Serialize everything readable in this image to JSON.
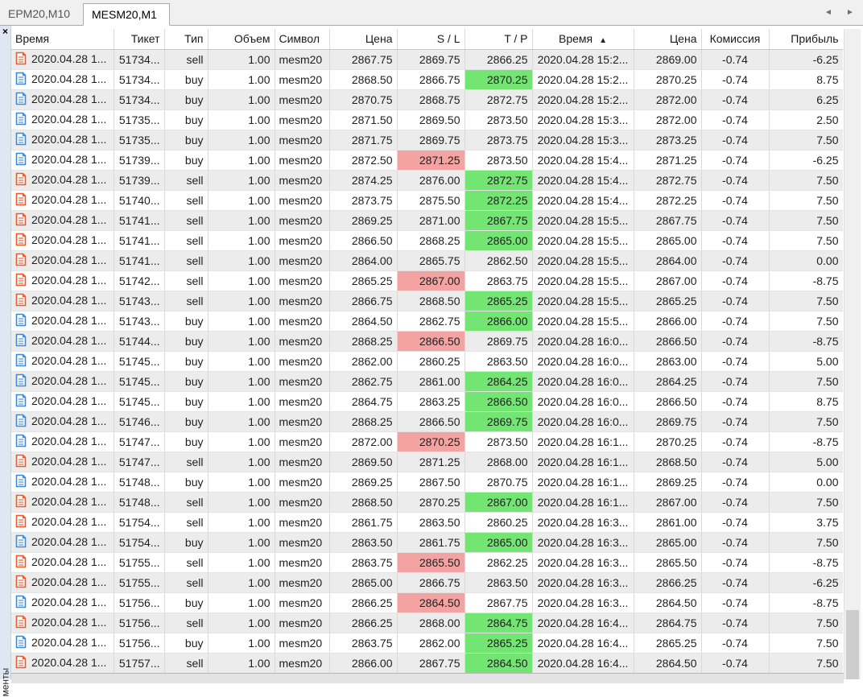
{
  "tabs": [
    {
      "label": "EPM20,M10",
      "active": false
    },
    {
      "label": "MESM20,M1",
      "active": true
    }
  ],
  "scroll": {
    "left_arrow": "◄",
    "right_arrow": "►"
  },
  "sidebar": {
    "close": "×",
    "label": "менты"
  },
  "colors": {
    "row_odd": "#ececec",
    "row_even": "#ffffff",
    "tp_hit": "#73e573",
    "sl_hit": "#f4a3a3",
    "sell_icon": "#e8592c",
    "buy_icon": "#3b8ad9"
  },
  "columns": [
    {
      "label": "Время",
      "align": "l"
    },
    {
      "label": "Тикет",
      "align": "r"
    },
    {
      "label": "Тип",
      "align": "r"
    },
    {
      "label": "Объем",
      "align": "r"
    },
    {
      "label": "Символ",
      "align": "l"
    },
    {
      "label": "Цена",
      "align": "r"
    },
    {
      "label": "S / L",
      "align": "r"
    },
    {
      "label": "T / P",
      "align": "r"
    },
    {
      "label": "Время",
      "align": "c",
      "sorted": "asc"
    },
    {
      "label": "Цена",
      "align": "r"
    },
    {
      "label": "Комиссия",
      "align": "c"
    },
    {
      "label": "Прибыль",
      "align": "r"
    }
  ],
  "sort_indicator": "▲",
  "rows": [
    {
      "time": "2020.04.28 1...",
      "ticket": "51734...",
      "type": "sell",
      "volume": "1.00",
      "symbol": "mesm20",
      "price": "2867.75",
      "sl": "2869.75",
      "tp": "2866.25",
      "close_time": "2020.04.28 15:2...",
      "close_price": "2869.00",
      "commission": "-0.74",
      "profit": "-6.25",
      "hl": ""
    },
    {
      "time": "2020.04.28 1...",
      "ticket": "51734...",
      "type": "buy",
      "volume": "1.00",
      "symbol": "mesm20",
      "price": "2868.50",
      "sl": "2866.75",
      "tp": "2870.25",
      "close_time": "2020.04.28 15:2...",
      "close_price": "2870.25",
      "commission": "-0.74",
      "profit": "8.75",
      "hl": "tp"
    },
    {
      "time": "2020.04.28 1...",
      "ticket": "51734...",
      "type": "buy",
      "volume": "1.00",
      "symbol": "mesm20",
      "price": "2870.75",
      "sl": "2868.75",
      "tp": "2872.75",
      "close_time": "2020.04.28 15:2...",
      "close_price": "2872.00",
      "commission": "-0.74",
      "profit": "6.25",
      "hl": ""
    },
    {
      "time": "2020.04.28 1...",
      "ticket": "51735...",
      "type": "buy",
      "volume": "1.00",
      "symbol": "mesm20",
      "price": "2871.50",
      "sl": "2869.50",
      "tp": "2873.50",
      "close_time": "2020.04.28 15:3...",
      "close_price": "2872.00",
      "commission": "-0.74",
      "profit": "2.50",
      "hl": ""
    },
    {
      "time": "2020.04.28 1...",
      "ticket": "51735...",
      "type": "buy",
      "volume": "1.00",
      "symbol": "mesm20",
      "price": "2871.75",
      "sl": "2869.75",
      "tp": "2873.75",
      "close_time": "2020.04.28 15:3...",
      "close_price": "2873.25",
      "commission": "-0.74",
      "profit": "7.50",
      "hl": ""
    },
    {
      "time": "2020.04.28 1...",
      "ticket": "51739...",
      "type": "buy",
      "volume": "1.00",
      "symbol": "mesm20",
      "price": "2872.50",
      "sl": "2871.25",
      "tp": "2873.50",
      "close_time": "2020.04.28 15:4...",
      "close_price": "2871.25",
      "commission": "-0.74",
      "profit": "-6.25",
      "hl": "sl"
    },
    {
      "time": "2020.04.28 1...",
      "ticket": "51739...",
      "type": "sell",
      "volume": "1.00",
      "symbol": "mesm20",
      "price": "2874.25",
      "sl": "2876.00",
      "tp": "2872.75",
      "close_time": "2020.04.28 15:4...",
      "close_price": "2872.75",
      "commission": "-0.74",
      "profit": "7.50",
      "hl": "tp"
    },
    {
      "time": "2020.04.28 1...",
      "ticket": "51740...",
      "type": "sell",
      "volume": "1.00",
      "symbol": "mesm20",
      "price": "2873.75",
      "sl": "2875.50",
      "tp": "2872.25",
      "close_time": "2020.04.28 15:4...",
      "close_price": "2872.25",
      "commission": "-0.74",
      "profit": "7.50",
      "hl": "tp"
    },
    {
      "time": "2020.04.28 1...",
      "ticket": "51741...",
      "type": "sell",
      "volume": "1.00",
      "symbol": "mesm20",
      "price": "2869.25",
      "sl": "2871.00",
      "tp": "2867.75",
      "close_time": "2020.04.28 15:5...",
      "close_price": "2867.75",
      "commission": "-0.74",
      "profit": "7.50",
      "hl": "tp"
    },
    {
      "time": "2020.04.28 1...",
      "ticket": "51741...",
      "type": "sell",
      "volume": "1.00",
      "symbol": "mesm20",
      "price": "2866.50",
      "sl": "2868.25",
      "tp": "2865.00",
      "close_time": "2020.04.28 15:5...",
      "close_price": "2865.00",
      "commission": "-0.74",
      "profit": "7.50",
      "hl": "tp"
    },
    {
      "time": "2020.04.28 1...",
      "ticket": "51741...",
      "type": "sell",
      "volume": "1.00",
      "symbol": "mesm20",
      "price": "2864.00",
      "sl": "2865.75",
      "tp": "2862.50",
      "close_time": "2020.04.28 15:5...",
      "close_price": "2864.00",
      "commission": "-0.74",
      "profit": "0.00",
      "hl": ""
    },
    {
      "time": "2020.04.28 1...",
      "ticket": "51742...",
      "type": "sell",
      "volume": "1.00",
      "symbol": "mesm20",
      "price": "2865.25",
      "sl": "2867.00",
      "tp": "2863.75",
      "close_time": "2020.04.28 15:5...",
      "close_price": "2867.00",
      "commission": "-0.74",
      "profit": "-8.75",
      "hl": "sl"
    },
    {
      "time": "2020.04.28 1...",
      "ticket": "51743...",
      "type": "sell",
      "volume": "1.00",
      "symbol": "mesm20",
      "price": "2866.75",
      "sl": "2868.50",
      "tp": "2865.25",
      "close_time": "2020.04.28 15:5...",
      "close_price": "2865.25",
      "commission": "-0.74",
      "profit": "7.50",
      "hl": "tp"
    },
    {
      "time": "2020.04.28 1...",
      "ticket": "51743...",
      "type": "buy",
      "volume": "1.00",
      "symbol": "mesm20",
      "price": "2864.50",
      "sl": "2862.75",
      "tp": "2866.00",
      "close_time": "2020.04.28 15:5...",
      "close_price": "2866.00",
      "commission": "-0.74",
      "profit": "7.50",
      "hl": "tp"
    },
    {
      "time": "2020.04.28 1...",
      "ticket": "51744...",
      "type": "buy",
      "volume": "1.00",
      "symbol": "mesm20",
      "price": "2868.25",
      "sl": "2866.50",
      "tp": "2869.75",
      "close_time": "2020.04.28 16:0...",
      "close_price": "2866.50",
      "commission": "-0.74",
      "profit": "-8.75",
      "hl": "sl"
    },
    {
      "time": "2020.04.28 1...",
      "ticket": "51745...",
      "type": "buy",
      "volume": "1.00",
      "symbol": "mesm20",
      "price": "2862.00",
      "sl": "2860.25",
      "tp": "2863.50",
      "close_time": "2020.04.28 16:0...",
      "close_price": "2863.00",
      "commission": "-0.74",
      "profit": "5.00",
      "hl": ""
    },
    {
      "time": "2020.04.28 1...",
      "ticket": "51745...",
      "type": "buy",
      "volume": "1.00",
      "symbol": "mesm20",
      "price": "2862.75",
      "sl": "2861.00",
      "tp": "2864.25",
      "close_time": "2020.04.28 16:0...",
      "close_price": "2864.25",
      "commission": "-0.74",
      "profit": "7.50",
      "hl": "tp"
    },
    {
      "time": "2020.04.28 1...",
      "ticket": "51745...",
      "type": "buy",
      "volume": "1.00",
      "symbol": "mesm20",
      "price": "2864.75",
      "sl": "2863.25",
      "tp": "2866.50",
      "close_time": "2020.04.28 16:0...",
      "close_price": "2866.50",
      "commission": "-0.74",
      "profit": "8.75",
      "hl": "tp"
    },
    {
      "time": "2020.04.28 1...",
      "ticket": "51746...",
      "type": "buy",
      "volume": "1.00",
      "symbol": "mesm20",
      "price": "2868.25",
      "sl": "2866.50",
      "tp": "2869.75",
      "close_time": "2020.04.28 16:0...",
      "close_price": "2869.75",
      "commission": "-0.74",
      "profit": "7.50",
      "hl": "tp"
    },
    {
      "time": "2020.04.28 1...",
      "ticket": "51747...",
      "type": "buy",
      "volume": "1.00",
      "symbol": "mesm20",
      "price": "2872.00",
      "sl": "2870.25",
      "tp": "2873.50",
      "close_time": "2020.04.28 16:1...",
      "close_price": "2870.25",
      "commission": "-0.74",
      "profit": "-8.75",
      "hl": "sl"
    },
    {
      "time": "2020.04.28 1...",
      "ticket": "51747...",
      "type": "sell",
      "volume": "1.00",
      "symbol": "mesm20",
      "price": "2869.50",
      "sl": "2871.25",
      "tp": "2868.00",
      "close_time": "2020.04.28 16:1...",
      "close_price": "2868.50",
      "commission": "-0.74",
      "profit": "5.00",
      "hl": ""
    },
    {
      "time": "2020.04.28 1...",
      "ticket": "51748...",
      "type": "buy",
      "volume": "1.00",
      "symbol": "mesm20",
      "price": "2869.25",
      "sl": "2867.50",
      "tp": "2870.75",
      "close_time": "2020.04.28 16:1...",
      "close_price": "2869.25",
      "commission": "-0.74",
      "profit": "0.00",
      "hl": ""
    },
    {
      "time": "2020.04.28 1...",
      "ticket": "51748...",
      "type": "sell",
      "volume": "1.00",
      "symbol": "mesm20",
      "price": "2868.50",
      "sl": "2870.25",
      "tp": "2867.00",
      "close_time": "2020.04.28 16:1...",
      "close_price": "2867.00",
      "commission": "-0.74",
      "profit": "7.50",
      "hl": "tp"
    },
    {
      "time": "2020.04.28 1...",
      "ticket": "51754...",
      "type": "sell",
      "volume": "1.00",
      "symbol": "mesm20",
      "price": "2861.75",
      "sl": "2863.50",
      "tp": "2860.25",
      "close_time": "2020.04.28 16:3...",
      "close_price": "2861.00",
      "commission": "-0.74",
      "profit": "3.75",
      "hl": ""
    },
    {
      "time": "2020.04.28 1...",
      "ticket": "51754...",
      "type": "buy",
      "volume": "1.00",
      "symbol": "mesm20",
      "price": "2863.50",
      "sl": "2861.75",
      "tp": "2865.00",
      "close_time": "2020.04.28 16:3...",
      "close_price": "2865.00",
      "commission": "-0.74",
      "profit": "7.50",
      "hl": "tp"
    },
    {
      "time": "2020.04.28 1...",
      "ticket": "51755...",
      "type": "sell",
      "volume": "1.00",
      "symbol": "mesm20",
      "price": "2863.75",
      "sl": "2865.50",
      "tp": "2862.25",
      "close_time": "2020.04.28 16:3...",
      "close_price": "2865.50",
      "commission": "-0.74",
      "profit": "-8.75",
      "hl": "sl"
    },
    {
      "time": "2020.04.28 1...",
      "ticket": "51755...",
      "type": "sell",
      "volume": "1.00",
      "symbol": "mesm20",
      "price": "2865.00",
      "sl": "2866.75",
      "tp": "2863.50",
      "close_time": "2020.04.28 16:3...",
      "close_price": "2866.25",
      "commission": "-0.74",
      "profit": "-6.25",
      "hl": ""
    },
    {
      "time": "2020.04.28 1...",
      "ticket": "51756...",
      "type": "buy",
      "volume": "1.00",
      "symbol": "mesm20",
      "price": "2866.25",
      "sl": "2864.50",
      "tp": "2867.75",
      "close_time": "2020.04.28 16:3...",
      "close_price": "2864.50",
      "commission": "-0.74",
      "profit": "-8.75",
      "hl": "sl"
    },
    {
      "time": "2020.04.28 1...",
      "ticket": "51756...",
      "type": "sell",
      "volume": "1.00",
      "symbol": "mesm20",
      "price": "2866.25",
      "sl": "2868.00",
      "tp": "2864.75",
      "close_time": "2020.04.28 16:4...",
      "close_price": "2864.75",
      "commission": "-0.74",
      "profit": "7.50",
      "hl": "tp"
    },
    {
      "time": "2020.04.28 1...",
      "ticket": "51756...",
      "type": "buy",
      "volume": "1.00",
      "symbol": "mesm20",
      "price": "2863.75",
      "sl": "2862.00",
      "tp": "2865.25",
      "close_time": "2020.04.28 16:4...",
      "close_price": "2865.25",
      "commission": "-0.74",
      "profit": "7.50",
      "hl": "tp"
    },
    {
      "time": "2020.04.28 1...",
      "ticket": "51757...",
      "type": "sell",
      "volume": "1.00",
      "symbol": "mesm20",
      "price": "2866.00",
      "sl": "2867.75",
      "tp": "2864.50",
      "close_time": "2020.04.28 16:4...",
      "close_price": "2864.50",
      "commission": "-0.74",
      "profit": "7.50",
      "hl": "tp"
    }
  ]
}
